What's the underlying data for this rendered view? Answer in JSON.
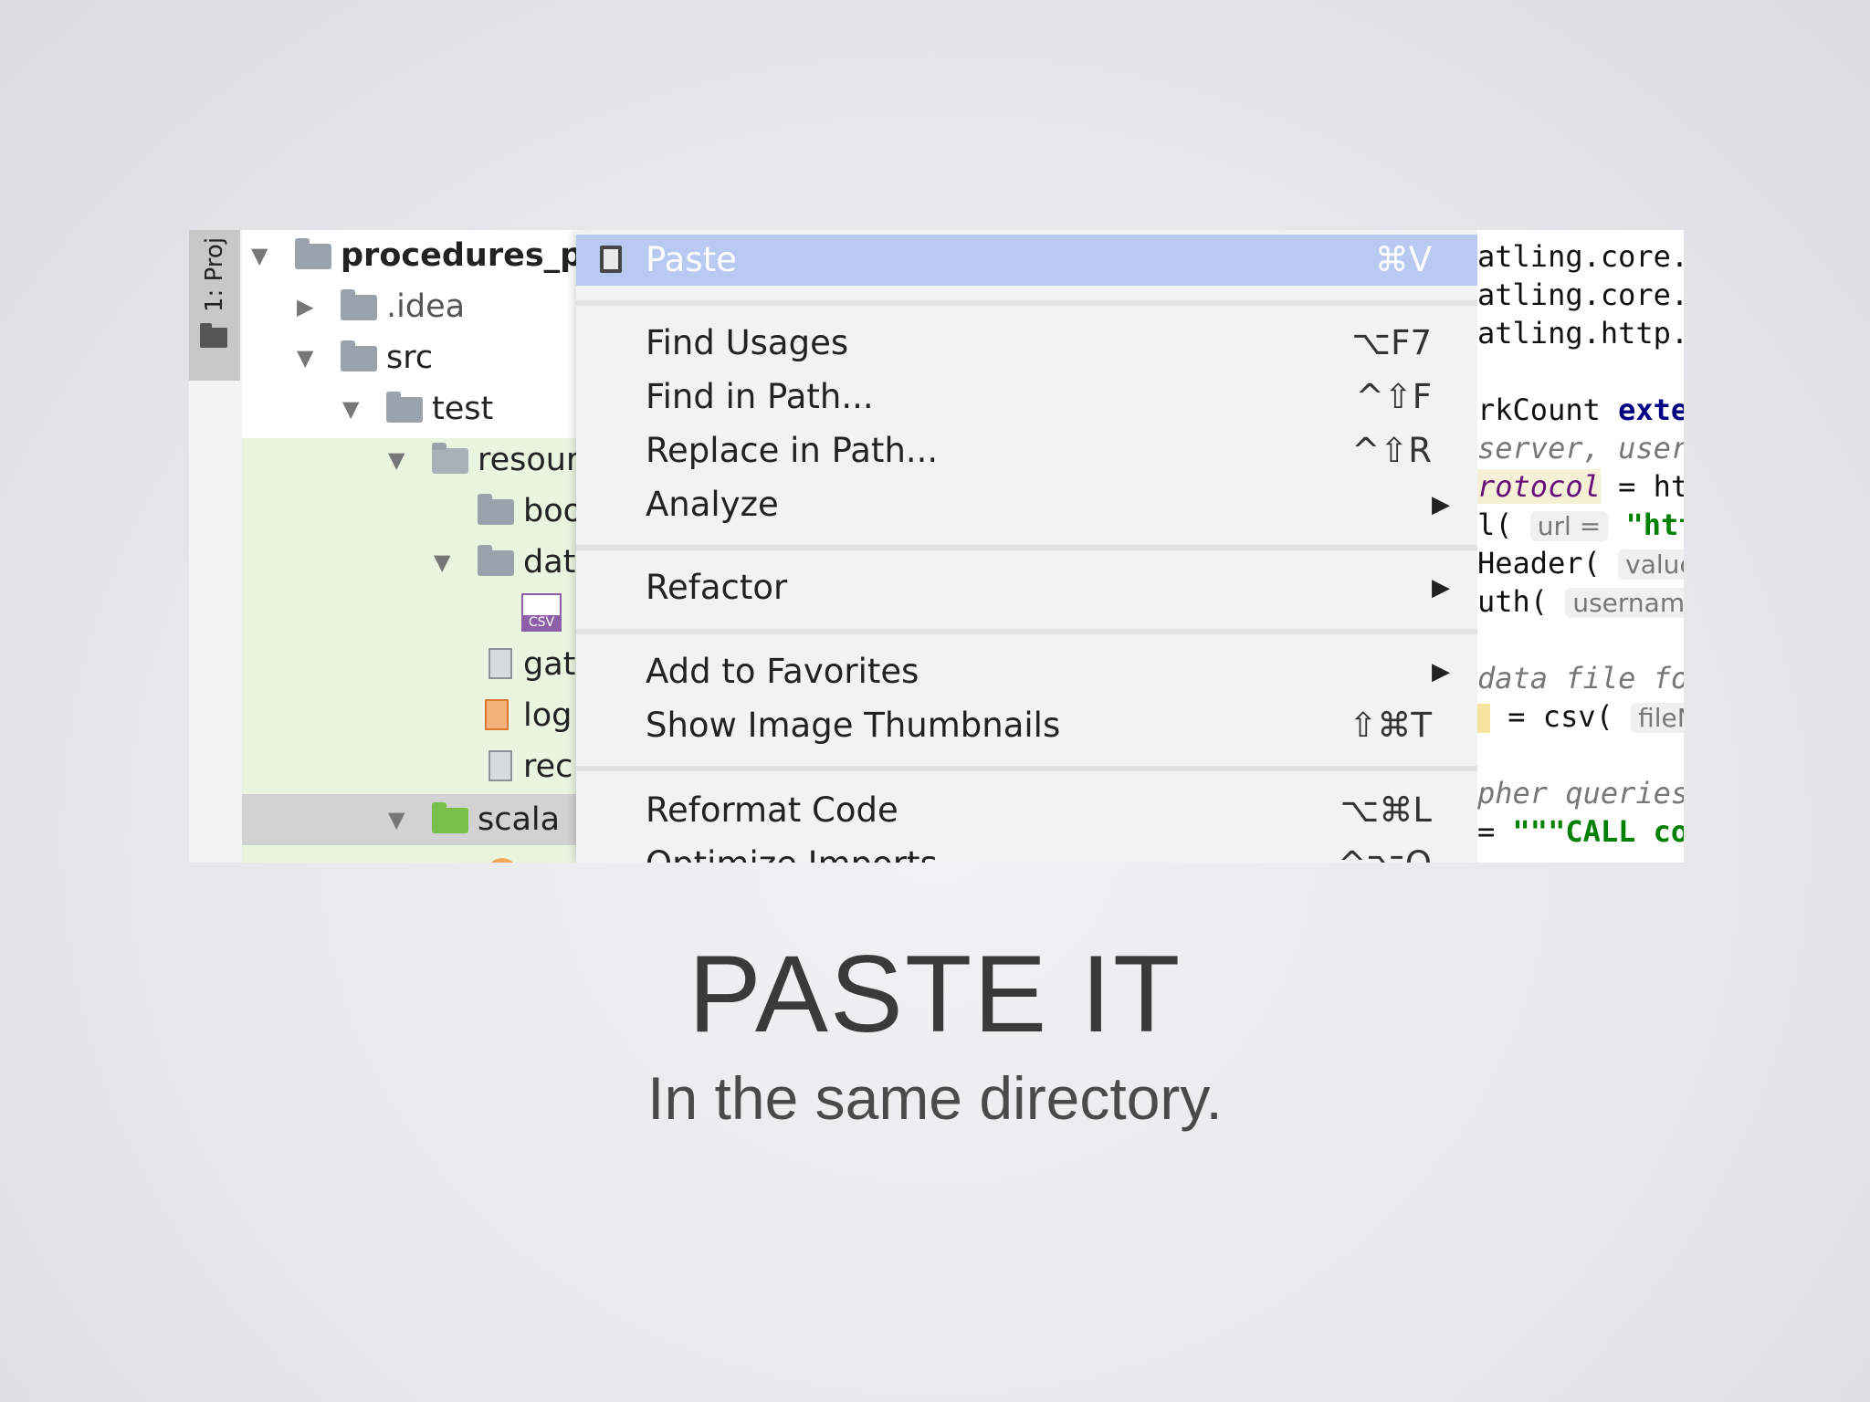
{
  "tool_window": {
    "label": "1: Proj"
  },
  "tree": {
    "items": [
      {
        "label": "procedures_pr"
      },
      {
        "label": ".idea"
      },
      {
        "label": "src"
      },
      {
        "label": "test"
      },
      {
        "label": "resour"
      },
      {
        "label": "boo"
      },
      {
        "label": "dat"
      },
      {
        "label": "CSV"
      },
      {
        "label": "gat"
      },
      {
        "label": "log"
      },
      {
        "label": "rec"
      },
      {
        "label": "scala"
      }
    ]
  },
  "menu": {
    "items": [
      {
        "label": "Paste",
        "shortcut": "⌘V"
      },
      {
        "label": "Find Usages",
        "shortcut": "⌥F7"
      },
      {
        "label": "Find in Path...",
        "shortcut": "^⇧F"
      },
      {
        "label": "Replace in Path...",
        "shortcut": "^⇧R"
      },
      {
        "label": "Analyze",
        "submenu": "▶"
      },
      {
        "label": "Refactor",
        "submenu": "▶"
      },
      {
        "label": "Add to Favorites",
        "submenu": "▶"
      },
      {
        "label": "Show Image Thumbnails",
        "shortcut": "⇧⌘T"
      },
      {
        "label": "Reformat Code",
        "shortcut": "⌥⌘L"
      },
      {
        "label": "Optimize Imports",
        "shortcut": "^⌥O"
      }
    ]
  },
  "code": {
    "lines": [
      "atling.core.I",
      "atling.core.:",
      "atling.http.I",
      "rkCount",
      "exter",
      "server, useri",
      "rotocol",
      "= ht",
      "l(",
      "url =",
      "\"http",
      "Header(",
      "value",
      "uth(",
      "username",
      "data file fo",
      "= csv(",
      "fileN",
      "pher queries",
      "=",
      "\"\"\"CALL co"
    ]
  },
  "caption": {
    "title": "PASTE IT",
    "subtitle": "In the same directory."
  }
}
